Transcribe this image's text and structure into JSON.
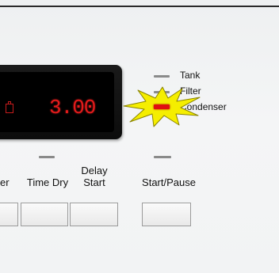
{
  "display": {
    "time_value": "3.00",
    "time_icon": "timer-icon"
  },
  "indicators": {
    "tank": "Tank",
    "filter": "Filter",
    "condenser": "Condenser",
    "active": "condenser",
    "alert_icon": "starburst-alert-icon",
    "colors": {
      "active_led": "#e01010",
      "inactive_led": "#8a8a8a",
      "display_text": "#e41b1b"
    }
  },
  "buttons": {
    "partial_left_label": "er",
    "time_dry_label": "Time Dry",
    "delay_start_line1": "Delay",
    "delay_start_line2": "Start",
    "start_pause_label": "Start/Pause"
  }
}
